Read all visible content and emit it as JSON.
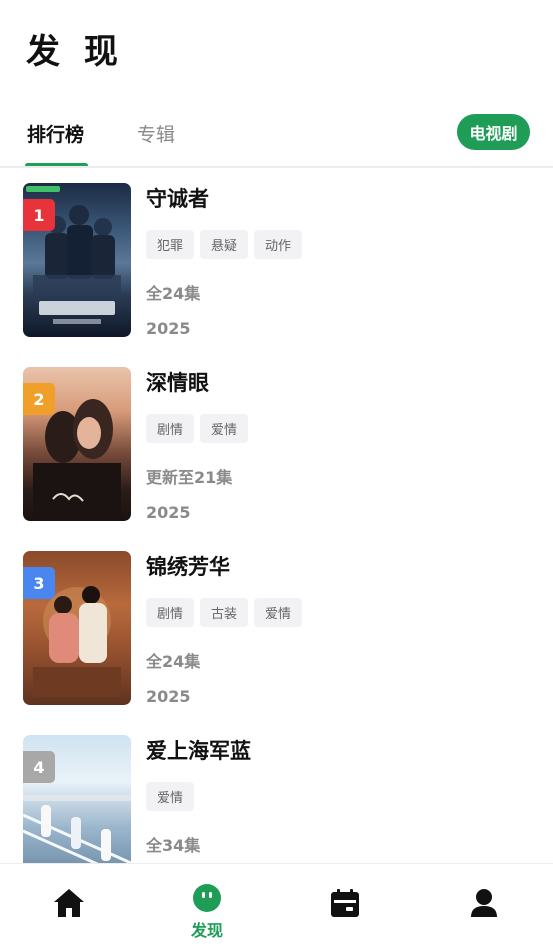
{
  "header": {
    "title": "发 现"
  },
  "tabs": {
    "items": [
      {
        "label": "排行榜",
        "active": true
      },
      {
        "label": "专辑",
        "active": false
      }
    ],
    "category_pill": "电视剧"
  },
  "colors": {
    "accent": "#1f9d57",
    "rank_1": "#e8333b",
    "rank_2": "#f0a02a",
    "rank_3": "#4a86f0",
    "rank_4": "#a8a8a8"
  },
  "ranking": [
    {
      "rank": "1",
      "title": "守诚者",
      "tags": [
        "犯罪",
        "悬疑",
        "动作"
      ],
      "episodes": "全24集",
      "year": "2025"
    },
    {
      "rank": "2",
      "title": "深情眼",
      "tags": [
        "剧情",
        "爱情"
      ],
      "episodes": "更新至21集",
      "year": "2025"
    },
    {
      "rank": "3",
      "title": "锦绣芳华",
      "tags": [
        "剧情",
        "古装",
        "爱情"
      ],
      "episodes": "全24集",
      "year": "2025"
    },
    {
      "rank": "4",
      "title": "爱上海军蓝",
      "tags": [
        "爱情"
      ],
      "episodes": "全34集",
      "year": ""
    }
  ],
  "bottom_nav": {
    "items": [
      {
        "icon": "home-icon",
        "label": ""
      },
      {
        "icon": "discover-icon",
        "label": "发现",
        "active": true
      },
      {
        "icon": "calendar-icon",
        "label": ""
      },
      {
        "icon": "user-icon",
        "label": ""
      }
    ]
  }
}
